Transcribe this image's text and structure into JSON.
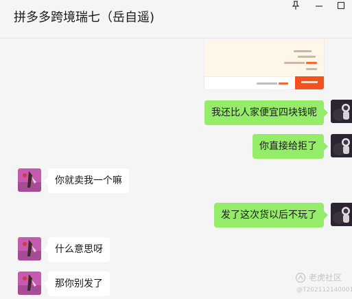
{
  "window": {
    "title": "拼多多跨境瑞七（岳自遥)"
  },
  "icons": {
    "pin": "pin-icon",
    "minimize": "minimize-icon",
    "maximize": "maximize-icon"
  },
  "messages": [
    {
      "side": "out",
      "type": "image",
      "content": "order-screenshot"
    },
    {
      "side": "out",
      "type": "text",
      "text": "我还比人家便宜四块钱呢"
    },
    {
      "side": "out",
      "type": "text",
      "text": "你直接给拒了"
    },
    {
      "side": "in",
      "type": "text",
      "text": "你就卖我一个嘛"
    },
    {
      "side": "out",
      "type": "text",
      "text": "发了这次货以后不玩了"
    },
    {
      "side": "in",
      "type": "text",
      "text": "什么意思呀"
    },
    {
      "side": "in",
      "type": "text",
      "text": "那你别发了"
    }
  ],
  "watermark": {
    "brand": "老虎社区",
    "id": "@T202112140001"
  },
  "colors": {
    "outgoing_bubble": "#95ec69",
    "incoming_bubble": "#ffffff",
    "background": "#f5f5f5"
  }
}
